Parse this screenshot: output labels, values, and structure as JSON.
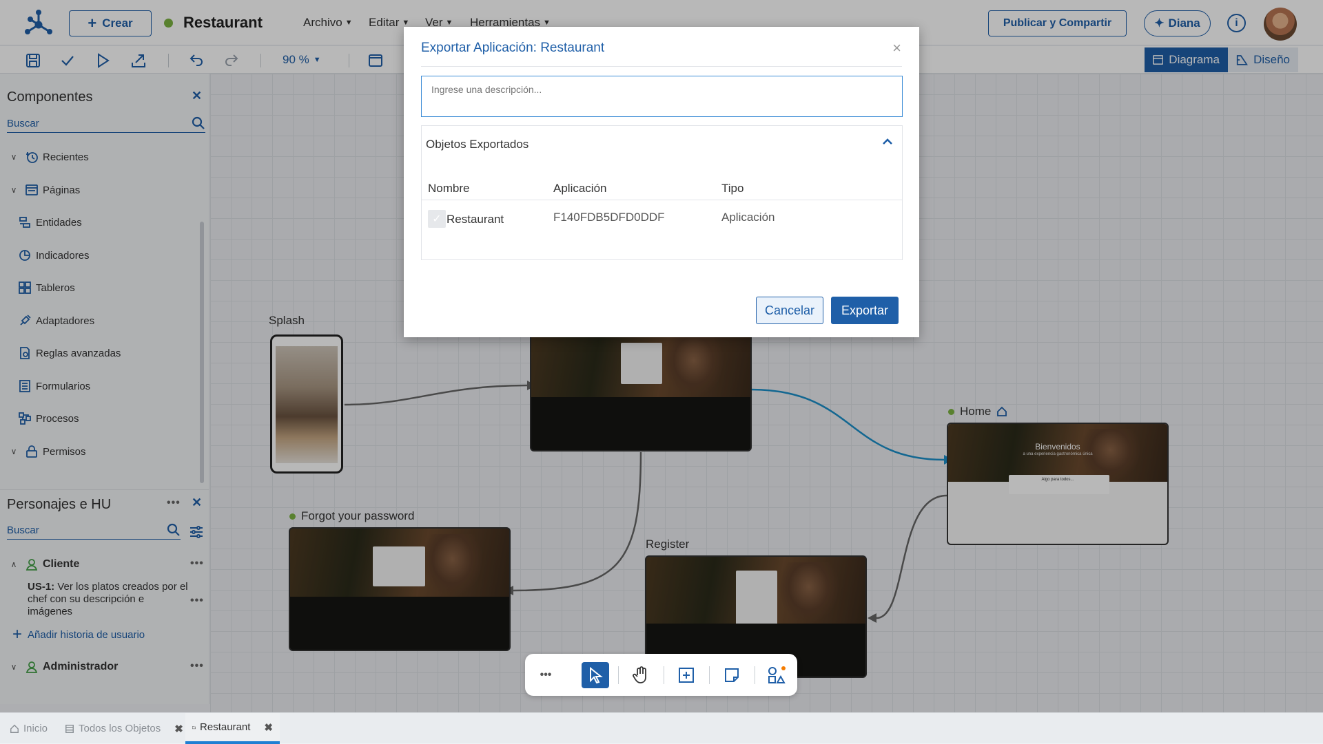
{
  "header": {
    "create_label": "Crear",
    "app_title": "Restaurant",
    "menus": [
      "Archivo",
      "Editar",
      "Ver",
      "Herramientas"
    ],
    "publish_label": "Publicar y Compartir",
    "assistant_label": "Diana"
  },
  "toolbar": {
    "zoom": "90 %",
    "view_diagram": "Diagrama",
    "view_design": "Diseño"
  },
  "components": {
    "title": "Componentes",
    "search_placeholder": "Buscar",
    "items": [
      "Recientes",
      "Páginas",
      "Entidades",
      "Indicadores",
      "Tableros",
      "Adaptadores",
      "Reglas avanzadas",
      "Formularios",
      "Procesos",
      "Permisos"
    ]
  },
  "personas": {
    "title": "Personajes e HU",
    "search_placeholder": "Buscar",
    "persona1": "Cliente",
    "story_id": "US-1:",
    "story_text": "Ver los platos creados por el chef con su descripción e imágenes",
    "add_story": "Añadir historia de usuario",
    "persona2": "Administrador"
  },
  "canvas": {
    "splash_label": "Splash",
    "forgot_label": "Forgot your password",
    "register_label": "Register",
    "home_label": "Home",
    "home_hero_title": "Bienvenidos",
    "home_hero_sub": "a una experiencia gastronómica única",
    "home_card_title": "Algo para todos..."
  },
  "tabs": [
    "Inicio",
    "Todos los Objetos",
    "Restaurant"
  ],
  "modal": {
    "title": "Exportar Aplicación: Restaurant",
    "description_placeholder": "Ingrese una descripción...",
    "section_title": "Objetos Exportados",
    "col_name": "Nombre",
    "col_app": "Aplicación",
    "col_type": "Tipo",
    "row_name": "Restaurant",
    "row_app": "F140FDB5DFD0DDF",
    "row_type": "Aplicación",
    "cancel_label": "Cancelar",
    "export_label": "Exportar"
  },
  "colors": {
    "primary": "#1f5fa8",
    "status_dot": "#7cb342",
    "flow_active": "#1b8fc9"
  }
}
